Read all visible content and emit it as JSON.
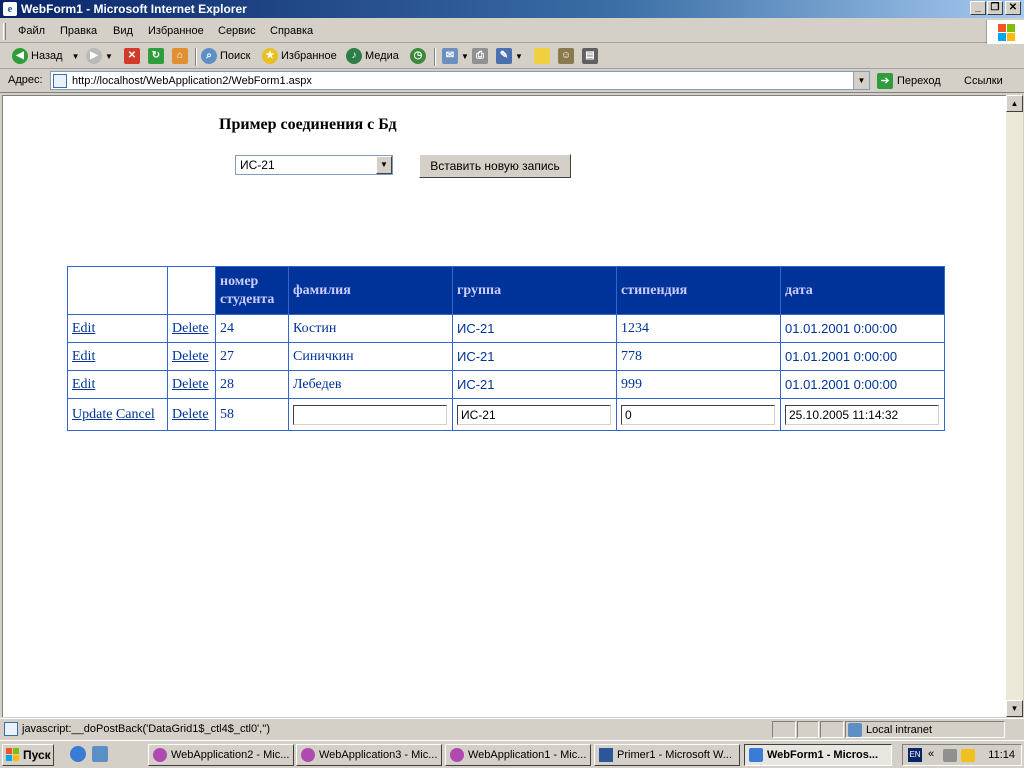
{
  "window": {
    "title": "WebForm1 - Microsoft Internet Explorer",
    "minimize": "_",
    "maximize": "❐",
    "close": "✕"
  },
  "menu": [
    "Файл",
    "Правка",
    "Вид",
    "Избранное",
    "Сервис",
    "Справка"
  ],
  "toolbar": {
    "back": "Назад",
    "search": "Поиск",
    "favorites": "Избранное",
    "media": "Медиа"
  },
  "address": {
    "label": "Адрес:",
    "url": "http://localhost/WebApplication2/WebForm1.aspx",
    "go": "Переход",
    "links": "Ссылки"
  },
  "page": {
    "title": "Пример соединения с Бд",
    "select_value": "ИС-21",
    "insert_button": "Вставить новую запись"
  },
  "grid": {
    "headers": [
      "номер студента",
      "фамилия",
      "группа",
      "стипендия",
      "дата"
    ],
    "rows": [
      {
        "edit": "Edit",
        "delete": "Delete",
        "id": "24",
        "surname": "Костин",
        "group": "ИС-21",
        "stipend": "1234",
        "date": "01.01.2001 0:00:00"
      },
      {
        "edit": "Edit",
        "delete": "Delete",
        "id": "27",
        "surname": "Синичкин",
        "group": "ИС-21",
        "stipend": "778",
        "date": "01.01.2001 0:00:00"
      },
      {
        "edit": "Edit",
        "delete": "Delete",
        "id": "28",
        "surname": "Лебедев",
        "group": "ИС-21",
        "stipend": "999",
        "date": "01.01.2001 0:00:00"
      }
    ],
    "edit_row": {
      "update": "Update",
      "cancel": "Cancel",
      "delete": "Delete",
      "id": "58",
      "surname": "",
      "group": "ИС-21",
      "stipend": "0",
      "date": "25.10.2005 11:14:32"
    }
  },
  "status": {
    "text": "javascript:__doPostBack('DataGrid1$_ctl4$_ctl0','')",
    "zone": "Local intranet"
  },
  "taskbar": {
    "start": "Пуск",
    "tasks": [
      "WebApplication2 - Mic...",
      "WebApplication3 - Mic...",
      "WebApplication1 - Mic...",
      "Primer1 - Microsoft W...",
      "WebForm1 - Micros..."
    ],
    "lang": "EN",
    "clock": "11:14"
  }
}
